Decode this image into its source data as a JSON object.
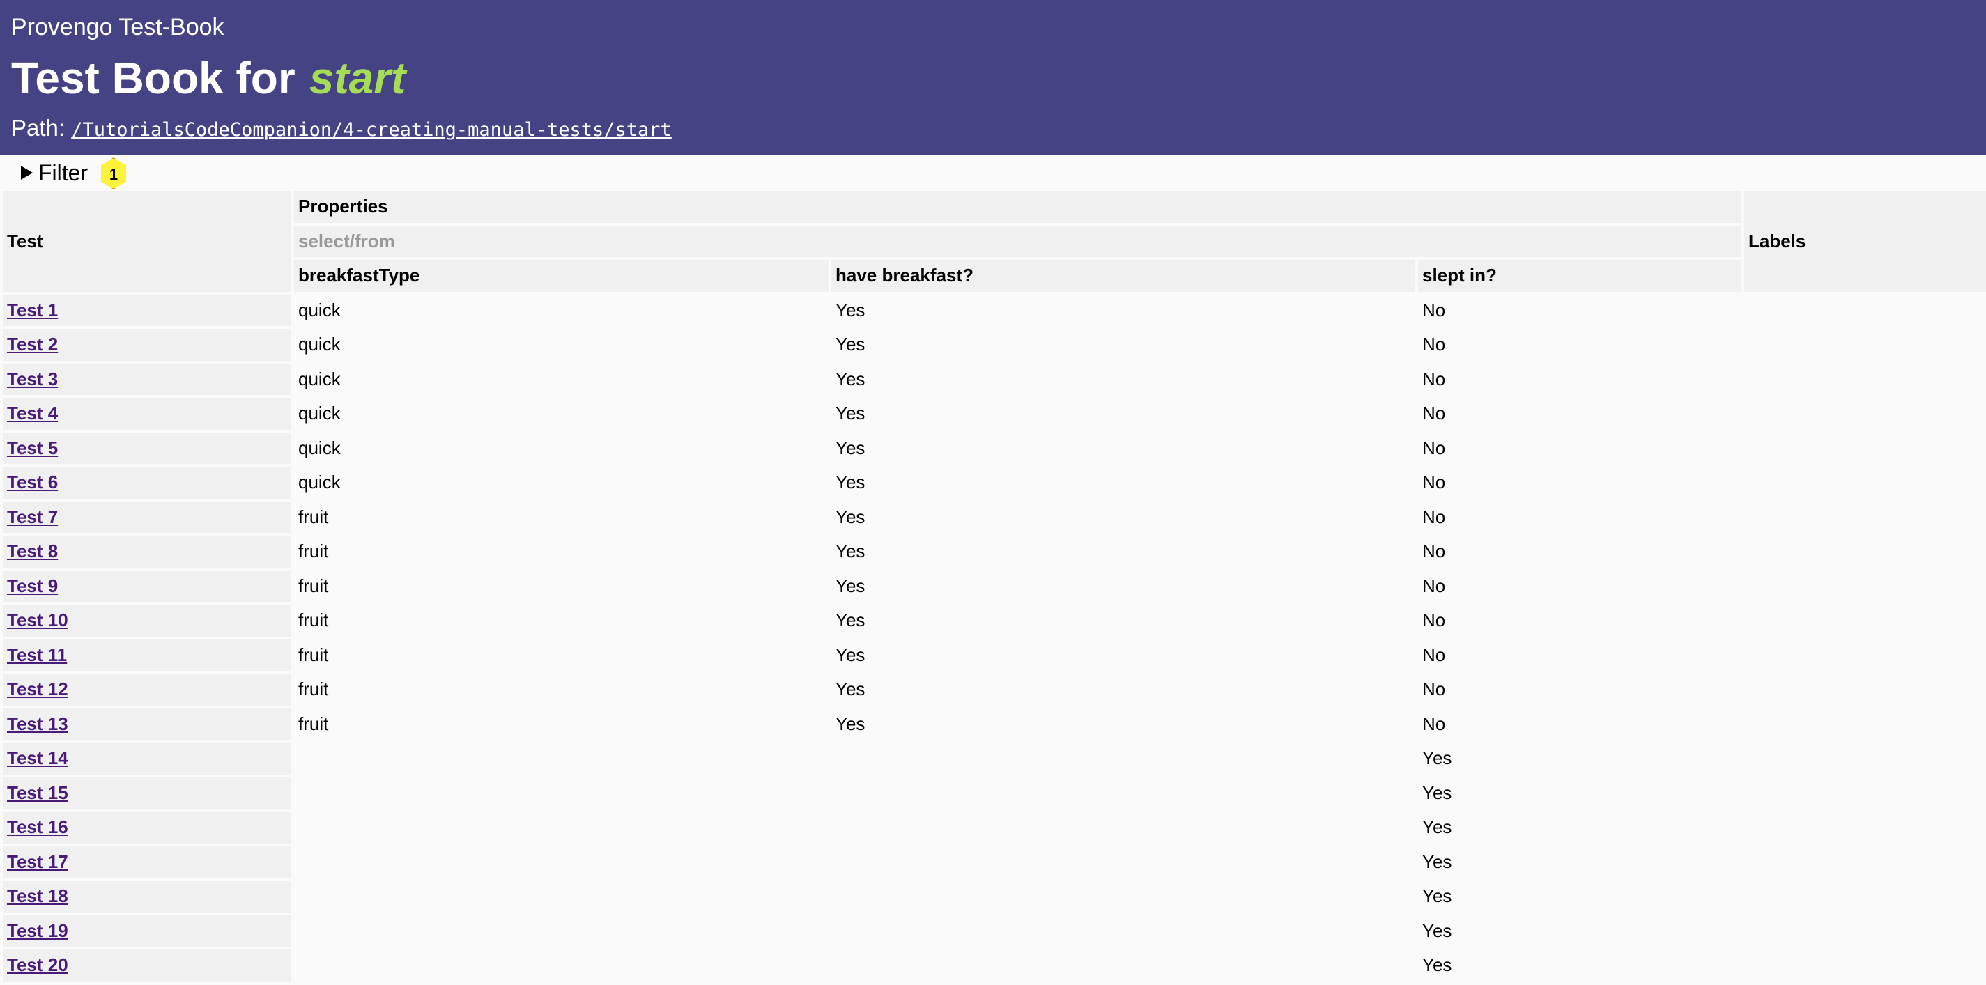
{
  "header": {
    "app_title": "Provengo Test-Book",
    "book_title_prefix": "Test Book for",
    "book_title_target": "start",
    "path_label": "Path:",
    "path_value": "/TutorialsCodeCompanion/4-creating-manual-tests/start"
  },
  "filter": {
    "label": "Filter",
    "badge": "1"
  },
  "table": {
    "test_header": "Test",
    "properties_header": "Properties",
    "properties_subheader": "select/from",
    "labels_header": "Labels",
    "columns": [
      "breakfastType",
      "have breakfast?",
      "slept in?"
    ],
    "rows": [
      {
        "test": "Test 1",
        "breakfastType": "quick",
        "have_breakfast": "Yes",
        "slept_in": "No"
      },
      {
        "test": "Test 2",
        "breakfastType": "quick",
        "have_breakfast": "Yes",
        "slept_in": "No"
      },
      {
        "test": "Test 3",
        "breakfastType": "quick",
        "have_breakfast": "Yes",
        "slept_in": "No"
      },
      {
        "test": "Test 4",
        "breakfastType": "quick",
        "have_breakfast": "Yes",
        "slept_in": "No"
      },
      {
        "test": "Test 5",
        "breakfastType": "quick",
        "have_breakfast": "Yes",
        "slept_in": "No"
      },
      {
        "test": "Test 6",
        "breakfastType": "quick",
        "have_breakfast": "Yes",
        "slept_in": "No"
      },
      {
        "test": "Test 7",
        "breakfastType": "fruit",
        "have_breakfast": "Yes",
        "slept_in": "No"
      },
      {
        "test": "Test 8",
        "breakfastType": "fruit",
        "have_breakfast": "Yes",
        "slept_in": "No"
      },
      {
        "test": "Test 9",
        "breakfastType": "fruit",
        "have_breakfast": "Yes",
        "slept_in": "No"
      },
      {
        "test": "Test 10",
        "breakfastType": "fruit",
        "have_breakfast": "Yes",
        "slept_in": "No"
      },
      {
        "test": "Test 11",
        "breakfastType": "fruit",
        "have_breakfast": "Yes",
        "slept_in": "No"
      },
      {
        "test": "Test 12",
        "breakfastType": "fruit",
        "have_breakfast": "Yes",
        "slept_in": "No"
      },
      {
        "test": "Test 13",
        "breakfastType": "fruit",
        "have_breakfast": "Yes",
        "slept_in": "No"
      },
      {
        "test": "Test 14",
        "breakfastType": "",
        "have_breakfast": "",
        "slept_in": "Yes"
      },
      {
        "test": "Test 15",
        "breakfastType": "",
        "have_breakfast": "",
        "slept_in": "Yes"
      },
      {
        "test": "Test 16",
        "breakfastType": "",
        "have_breakfast": "",
        "slept_in": "Yes"
      },
      {
        "test": "Test 17",
        "breakfastType": "",
        "have_breakfast": "",
        "slept_in": "Yes"
      },
      {
        "test": "Test 18",
        "breakfastType": "",
        "have_breakfast": "",
        "slept_in": "Yes"
      },
      {
        "test": "Test 19",
        "breakfastType": "",
        "have_breakfast": "",
        "slept_in": "Yes"
      },
      {
        "test": "Test 20",
        "breakfastType": "",
        "have_breakfast": "",
        "slept_in": "Yes"
      }
    ]
  }
}
